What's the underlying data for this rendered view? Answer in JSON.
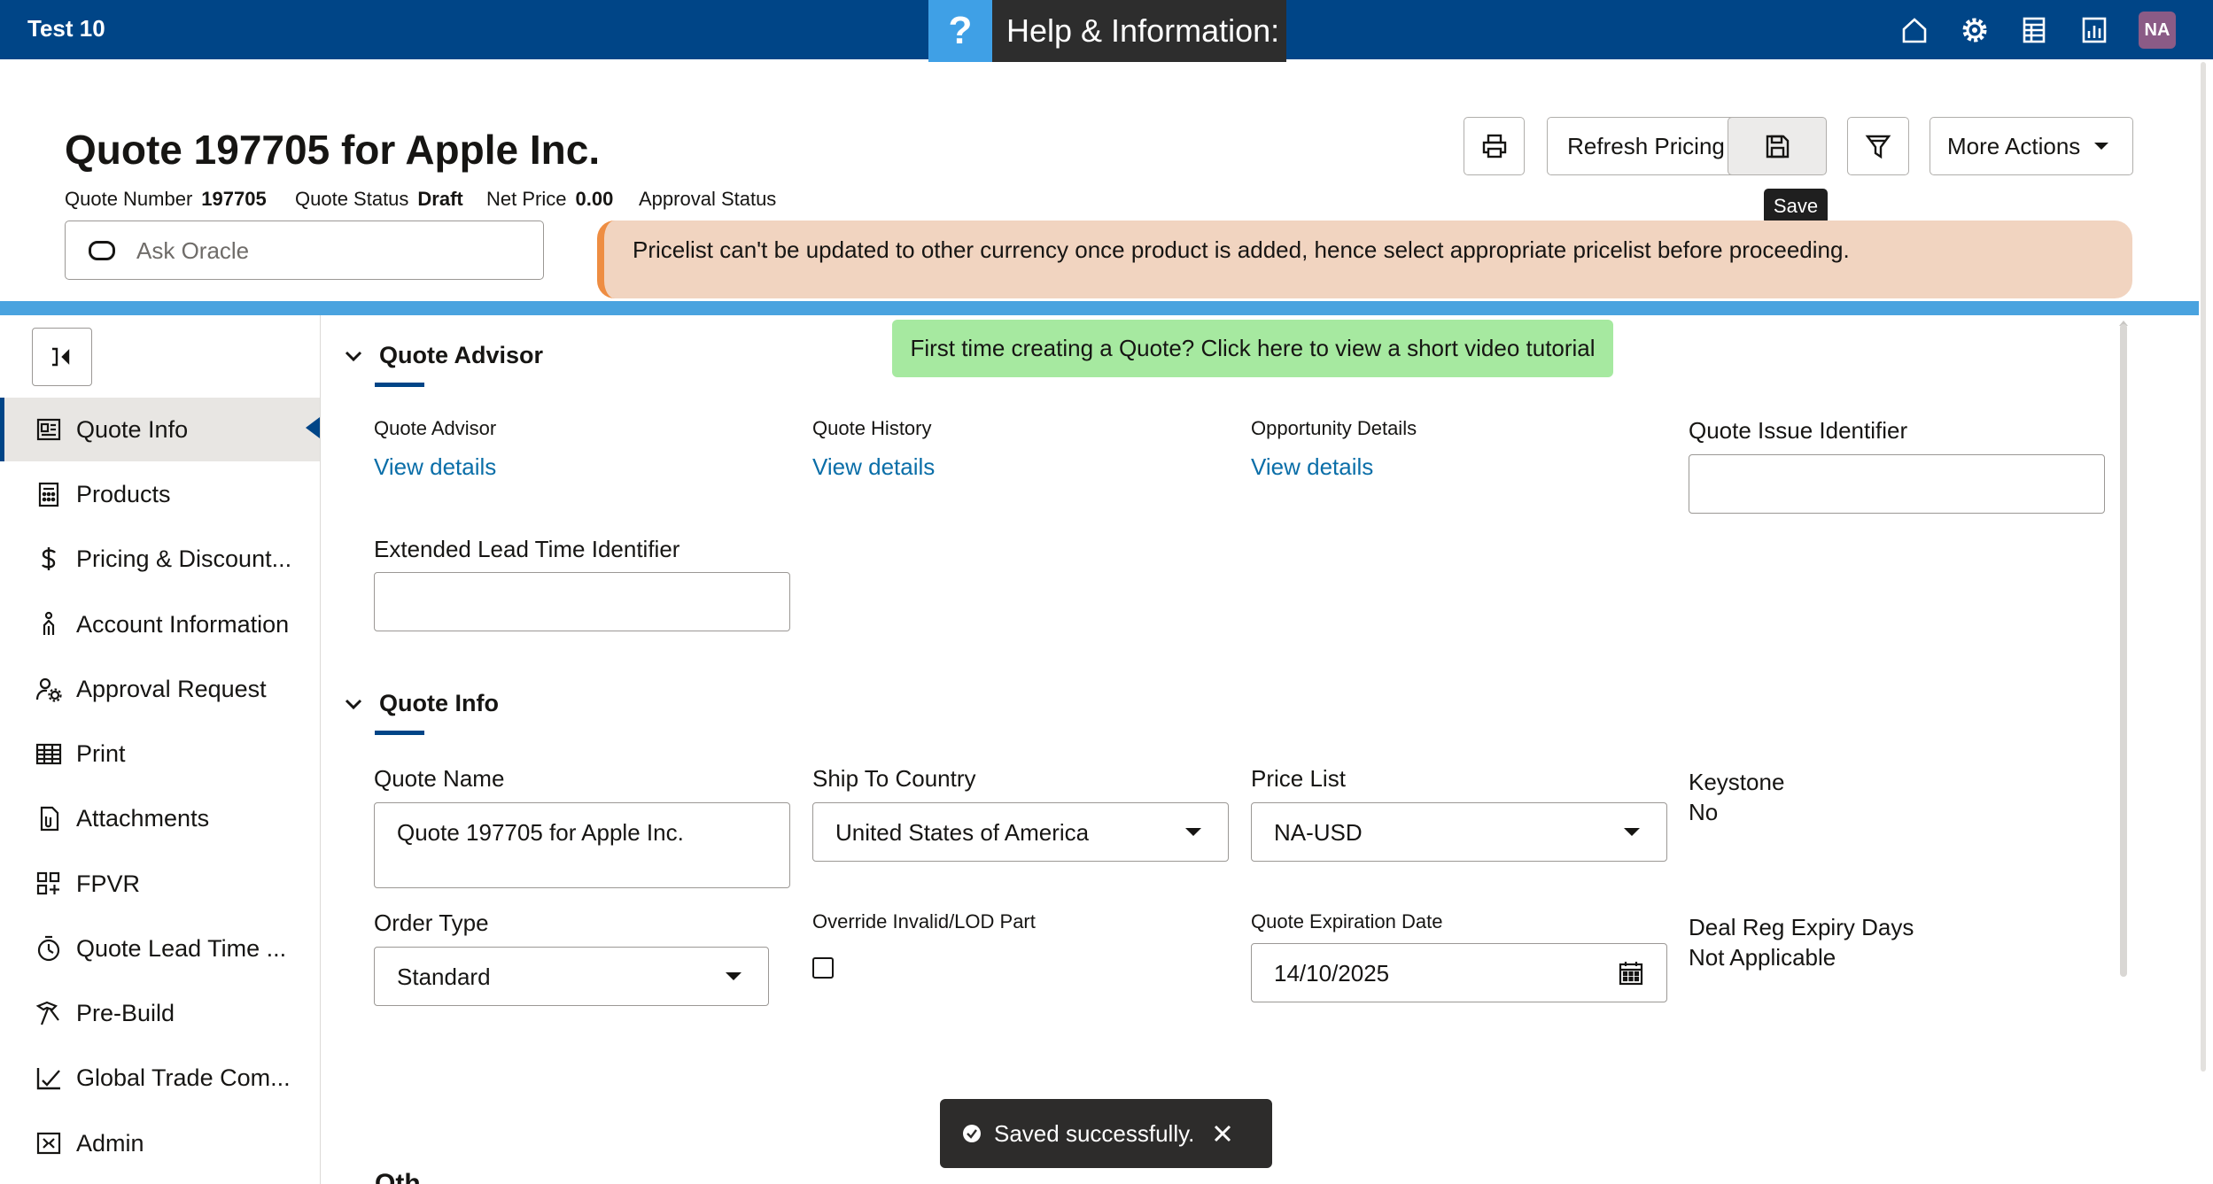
{
  "app": {
    "name": "Test 10",
    "help_icon": "?",
    "help_label": "Help & Information:",
    "avatar_initials": "NA"
  },
  "topbar_icons": [
    "home-icon",
    "gear-icon",
    "report-icon",
    "bar-chart-icon"
  ],
  "header": {
    "title": "Quote 197705 for Apple Inc.",
    "meta": {
      "quote_number_label": "Quote Number",
      "quote_number": "197705",
      "quote_status_label": "Quote Status",
      "quote_status": "Draft",
      "net_price_label": "Net Price",
      "net_price": "0.00",
      "approval_status_label": "Approval Status"
    },
    "buttons": {
      "refresh": "Refresh Pricing",
      "more_actions": "More Actions"
    },
    "save_tooltip": "Save",
    "ask_placeholder": "Ask Oracle",
    "notice": "Pricelist can't be updated to other currency once product is added, hence select appropriate pricelist before proceeding."
  },
  "sidebar": {
    "items": [
      {
        "label": "Quote Info",
        "icon": "quote-info-icon"
      },
      {
        "label": "Products",
        "icon": "products-icon"
      },
      {
        "label": "Pricing & Discount...",
        "icon": "dollar-icon"
      },
      {
        "label": "Account Information",
        "icon": "person-icon"
      },
      {
        "label": "Approval Request",
        "icon": "user-gear-icon"
      },
      {
        "label": "Print",
        "icon": "table-icon"
      },
      {
        "label": "Attachments",
        "icon": "attachment-icon"
      },
      {
        "label": "FPVR",
        "icon": "grid-plus-icon"
      },
      {
        "label": "Quote Lead Time ...",
        "icon": "timer-icon"
      },
      {
        "label": "Pre-Build",
        "icon": "hammer-icon"
      },
      {
        "label": "Global Trade Com...",
        "icon": "chart-check-icon"
      },
      {
        "label": "Admin",
        "icon": "admin-icon"
      }
    ]
  },
  "video_banner": "First time creating a Quote? Click here to view a short video tutorial",
  "quote_advisor": {
    "title": "Quote Advisor",
    "cols": [
      {
        "label": "Quote Advisor",
        "link": "View details"
      },
      {
        "label": "Quote History",
        "link": "View details"
      },
      {
        "label": "Opportunity Details",
        "link": "View details"
      }
    ],
    "issue_identifier_label": "Quote Issue Identifier",
    "issue_identifier_value": "",
    "lead_time_label": "Extended Lead Time Identifier",
    "lead_time_value": ""
  },
  "quote_info": {
    "title": "Quote Info",
    "quote_name_label": "Quote Name",
    "quote_name": "Quote 197705 for Apple Inc.",
    "ship_to_label": "Ship To Country",
    "ship_to": "United States of America",
    "price_list_label": "Price List",
    "price_list": "NA-USD",
    "keystone_label": "Keystone",
    "keystone": "No",
    "order_type_label": "Order Type",
    "order_type": "Standard",
    "override_label": "Override Invalid/LOD Part",
    "expiration_label": "Quote Expiration Date",
    "expiration": "14/10/2025",
    "deal_reg_label": "Deal Reg Expiry Days",
    "deal_reg": "Not Applicable"
  },
  "partial_heading": "Oth",
  "toast": {
    "message": "Saved successfully."
  }
}
